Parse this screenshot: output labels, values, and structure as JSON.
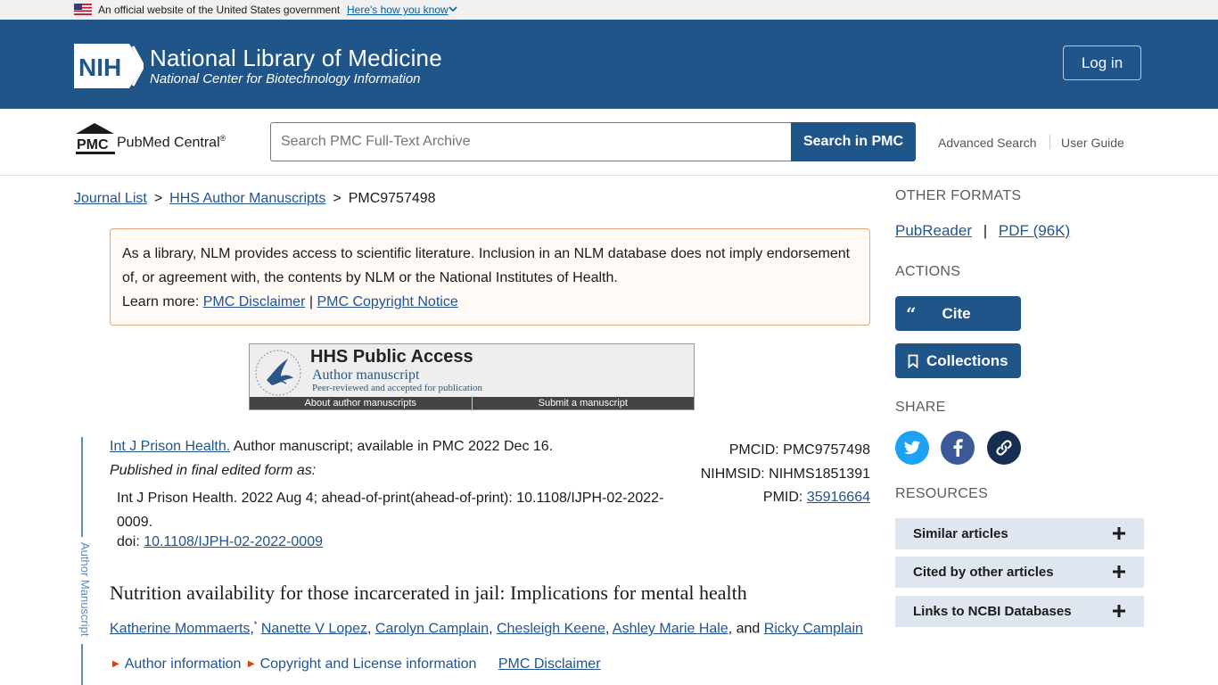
{
  "gov_banner": {
    "text": "An official website of the United States government",
    "how_link": "Here's how you know"
  },
  "header": {
    "logo_text": "NIH",
    "title": "National Library of Medicine",
    "subtitle": "National Center for Biotechnology Information",
    "login": "Log in",
    "color": "#20558a"
  },
  "search": {
    "brand_logo": "PMC",
    "brand": "PubMed Central",
    "brand_reg": "®",
    "placeholder": "Search PMC Full-Text Archive",
    "button": "Search in PMC",
    "advanced": "Advanced Search",
    "guide": "User Guide"
  },
  "breadcrumb": {
    "items": [
      "Journal List",
      "HHS Author Manuscripts",
      "PMC9757498"
    ],
    "sep": ">"
  },
  "disclaimer": {
    "text": "As a library, NLM provides access to scientific literature. Inclusion in an NLM database does not imply endorsement of, or agreement with, the contents by NLM or the National Institutes of Health.",
    "learn_more": "Learn more:",
    "link1": "PMC Disclaimer",
    "divider": "|",
    "link2": "PMC Copyright Notice"
  },
  "hhs_banner": {
    "title": "HHS Public Access",
    "subtitle": "Author manuscript",
    "note": "Peer-reviewed and accepted for publication",
    "link1": "About author manuscripts",
    "link2": "Submit a manuscript"
  },
  "side_label": "Author Manuscript",
  "citation": {
    "journal": "Int J Prison Health.",
    "availability": " Author manuscript; available in PMC 2022 Dec 16.",
    "published_as": "Published in final edited form as:",
    "final_ref": "Int J Prison Health. 2022 Aug 4; ahead-of-print(ahead-of-print): 10.1108/IJPH-02-2022-0009.",
    "doi_label": "doi: ",
    "doi": "10.1108/IJPH-02-2022-0009",
    "pmcid_label": "PMCID:",
    "pmcid": "PMC9757498",
    "nihmsid_label": "NIHMSID:",
    "nihmsid": "NIHMS1851391",
    "pmid_label": "PMID:",
    "pmid": "35916664"
  },
  "article": {
    "title": "Nutrition availability for those incarcerated in jail: Implications for mental health",
    "authors": [
      "Katherine Mommaerts",
      "Nanette V Lopez",
      "Carolyn Camplain",
      "Chesleigh Keene",
      "Ashley Marie Hale",
      "Ricky Camplain"
    ],
    "author_note": "*",
    "and": "and",
    "comma": ",",
    "expanders": [
      "Author information",
      "Copyright and License information"
    ],
    "disclaimer_link": "PMC Disclaimer"
  },
  "sidebar": {
    "formats_heading": "OTHER FORMATS",
    "pubreader": "PubReader",
    "fmt_sep": "|",
    "pdf": "PDF (96K)",
    "actions_heading": "ACTIONS",
    "cite": "Cite",
    "cite_icon": "quote-icon",
    "collections": "Collections",
    "share_heading": "SHARE",
    "share": [
      {
        "icon": "twitter-icon",
        "color": "#1da1f2"
      },
      {
        "icon": "facebook-icon",
        "color": "#3b5998"
      },
      {
        "icon": "link-icon",
        "color": "#162e51"
      }
    ],
    "resources_heading": "RESOURCES",
    "resources": [
      "Similar articles",
      "Cited by other articles",
      "Links to NCBI Databases"
    ]
  }
}
